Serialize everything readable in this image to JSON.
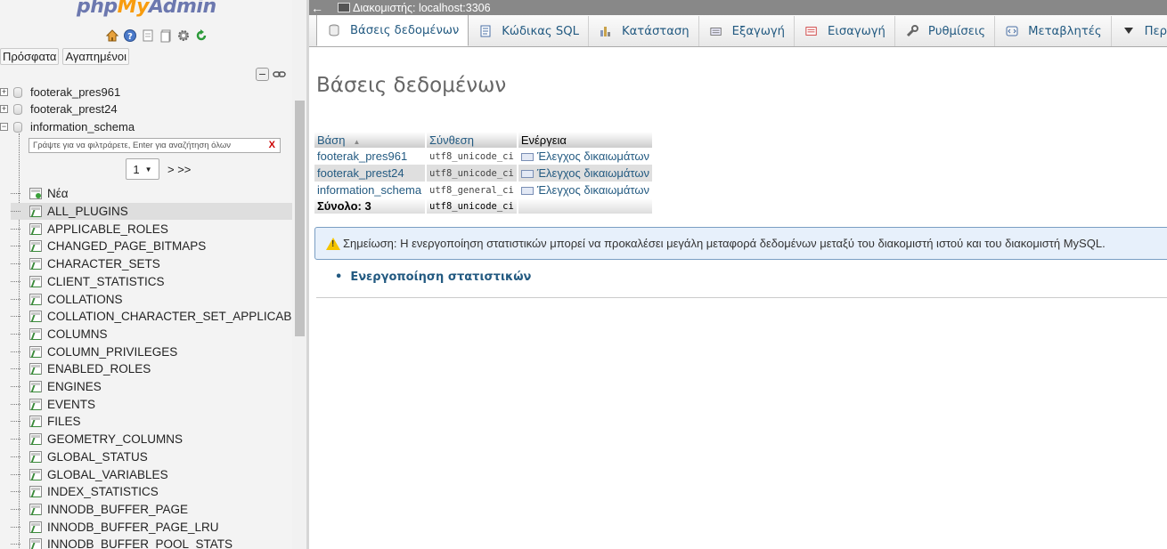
{
  "nav": {
    "logo": {
      "php": "php",
      "my": "My",
      "admin": "Admin"
    },
    "recent_tab": "Πρόσφατα",
    "favorites_tab": "Αγαπημένοι",
    "databases": [
      {
        "name": "footerak_pres961",
        "expander": "+"
      },
      {
        "name": "footerak_prest24",
        "expander": "+"
      },
      {
        "name": "information_schema",
        "expander": "−"
      }
    ],
    "filter_placeholder": "Γράψτε για να φιλτράρετε, Enter για αναζήτηση όλων",
    "filter_clear": "X",
    "page_select": "1",
    "pager_next": "> >>",
    "new_label": "Νέα",
    "tables": [
      "ALL_PLUGINS",
      "APPLICABLE_ROLES",
      "CHANGED_PAGE_BITMAPS",
      "CHARACTER_SETS",
      "CLIENT_STATISTICS",
      "COLLATIONS",
      "COLLATION_CHARACTER_SET_APPLICABILITY",
      "COLUMNS",
      "COLUMN_PRIVILEGES",
      "ENABLED_ROLES",
      "ENGINES",
      "EVENTS",
      "FILES",
      "GEOMETRY_COLUMNS",
      "GLOBAL_STATUS",
      "GLOBAL_VARIABLES",
      "INDEX_STATISTICS",
      "INNODB_BUFFER_PAGE",
      "INNODB_BUFFER_PAGE_LRU",
      "INNODB_BUFFER_POOL_STATS"
    ],
    "selected_table": "ALL_PLUGINS"
  },
  "server_bar": {
    "back": "←",
    "label": "Διακομιστής: localhost:3306"
  },
  "tabs": [
    {
      "label": "Βάσεις δεδομένων",
      "icon": "database-icon",
      "active": true
    },
    {
      "label": "Κώδικας SQL",
      "icon": "sql-icon"
    },
    {
      "label": "Κατάσταση",
      "icon": "status-icon"
    },
    {
      "label": "Εξαγωγή",
      "icon": "export-icon"
    },
    {
      "label": "Εισαγωγή",
      "icon": "import-icon"
    },
    {
      "label": "Ρυθμίσεις",
      "icon": "wrench-icon"
    },
    {
      "label": "Μεταβλητές",
      "icon": "variables-icon"
    },
    {
      "label": "Περισσότερα",
      "icon": "caret-down-icon"
    }
  ],
  "main": {
    "title": "Βάσεις δεδομένων",
    "table": {
      "headers": {
        "db": "Βάση",
        "collation": "Σύνθεση",
        "action": "Ενέργεια"
      },
      "rows": [
        {
          "db": "footerak_pres961",
          "collation": "utf8_unicode_ci",
          "action": "Έλεγχος δικαιωμάτων"
        },
        {
          "db": "footerak_prest24",
          "collation": "utf8_unicode_ci",
          "action": "Έλεγχος δικαιωμάτων"
        },
        {
          "db": "information_schema",
          "collation": "utf8_general_ci",
          "action": "Έλεγχος δικαιωμάτων"
        }
      ],
      "total": {
        "label": "Σύνολο: 3",
        "collation": "utf8_unicode_ci"
      }
    },
    "notice": "Σημείωση: Η ενεργοποίηση στατιστικών μπορεί να προκαλέσει μεγάλη μεταφορά δεδομένων μεταξύ του διακομιστή ιστού και του διακομιστή MySQL.",
    "enable_stats": "Ενεργοποίηση στατιστικών"
  },
  "colors": {
    "link": "#235a81",
    "accent_orange": "#f89c0e",
    "logo_blue": "#6c78af"
  }
}
